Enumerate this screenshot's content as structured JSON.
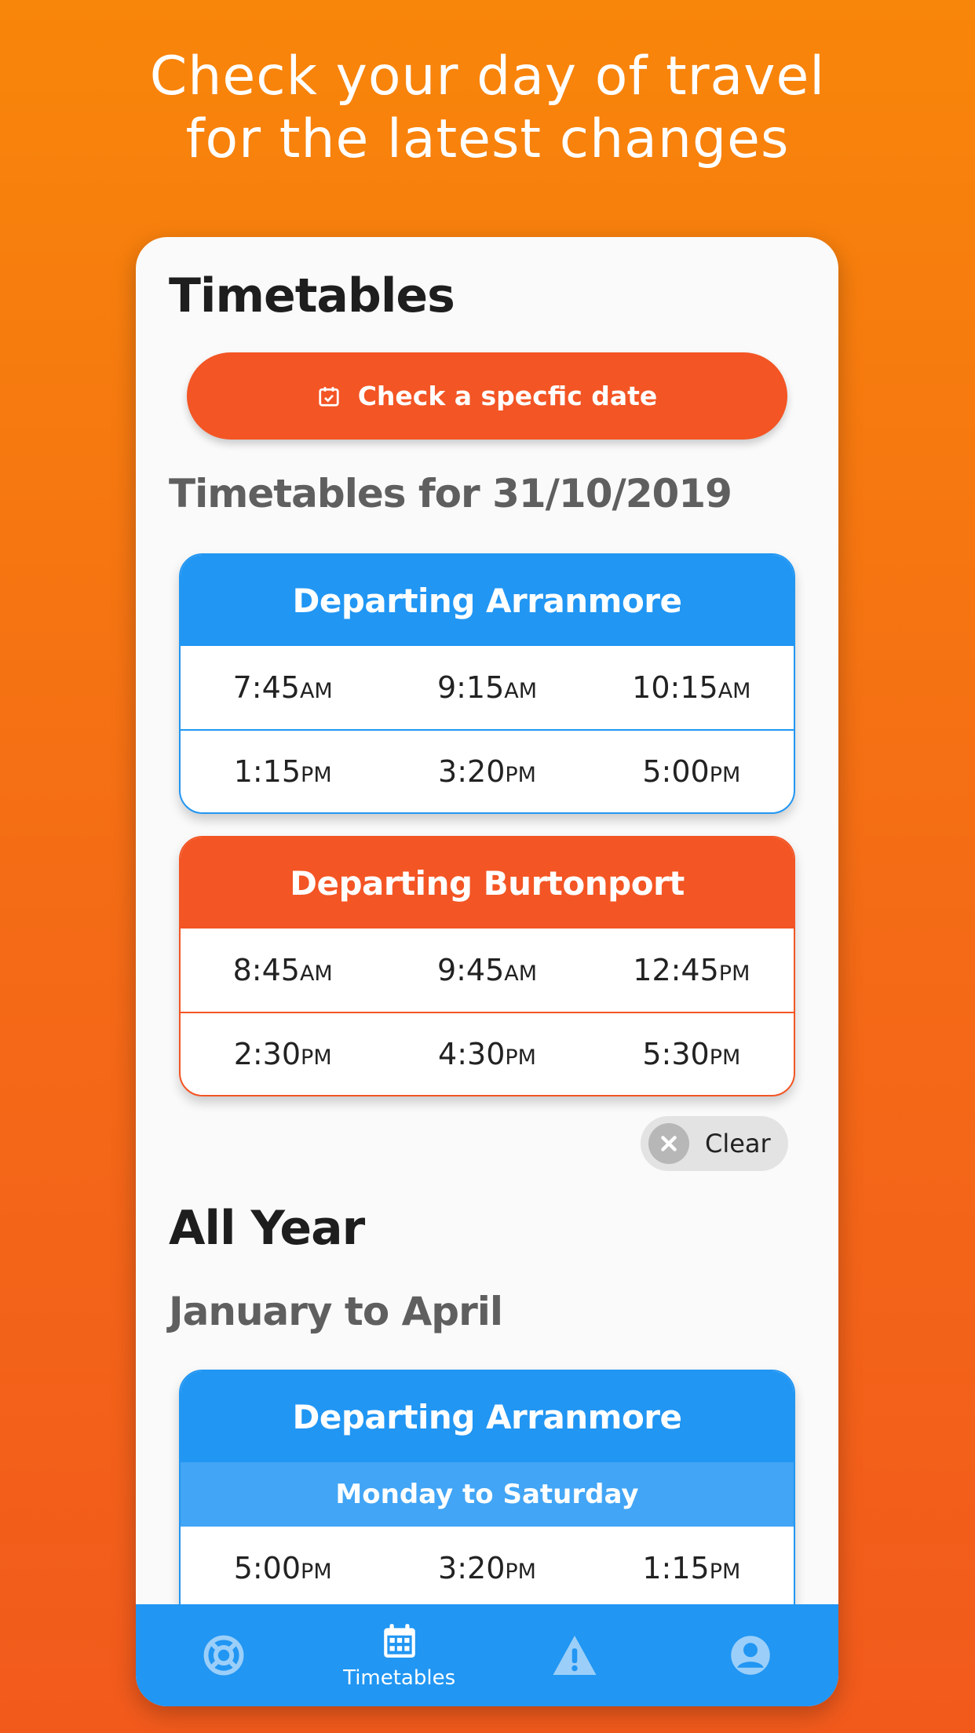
{
  "hero": {
    "line1": "Check your day of travel",
    "line2": "for the latest changes"
  },
  "screen": {
    "title": "Timetables",
    "check_date_button": {
      "label": "Check a specfic date",
      "icon": "calendar-check-icon"
    },
    "date_section_title": "Timetables for 31/10/2019",
    "date_cards": [
      {
        "title": "Departing Arranmore",
        "color": "#2196f3",
        "rows": [
          [
            {
              "t": "7:45",
              "p": "AM"
            },
            {
              "t": "9:15",
              "p": "AM"
            },
            {
              "t": "10:15",
              "p": "AM"
            }
          ],
          [
            {
              "t": "1:15",
              "p": "PM"
            },
            {
              "t": "3:20",
              "p": "PM"
            },
            {
              "t": "5:00",
              "p": "PM"
            }
          ]
        ]
      },
      {
        "title": "Departing Burtonport",
        "color": "#f35524",
        "rows": [
          [
            {
              "t": "8:45",
              "p": "AM"
            },
            {
              "t": "9:45",
              "p": "AM"
            },
            {
              "t": "12:45",
              "p": "PM"
            }
          ],
          [
            {
              "t": "2:30",
              "p": "PM"
            },
            {
              "t": "4:30",
              "p": "PM"
            },
            {
              "t": "5:30",
              "p": "PM"
            }
          ]
        ]
      }
    ],
    "clear_button": {
      "label": "Clear",
      "icon": "close-circle-icon"
    },
    "all_year_title": "All Year",
    "season_title": "January to April",
    "season_card": {
      "title": "Departing Arranmore",
      "subtitle": "Monday to Saturday",
      "rows": [
        [
          {
            "t": "5:00",
            "p": "PM"
          },
          {
            "t": "3:20",
            "p": "PM"
          },
          {
            "t": "1:15",
            "p": "PM"
          }
        ]
      ]
    },
    "nav": [
      {
        "icon": "lifebuoy-icon",
        "label": ""
      },
      {
        "icon": "calendar-icon",
        "label": "Timetables"
      },
      {
        "icon": "warning-icon",
        "label": ""
      },
      {
        "icon": "account-icon",
        "label": ""
      }
    ]
  },
  "colors": {
    "accent_blue": "#2196f3",
    "accent_orange": "#f35524",
    "background_gradient_top": "#f8860a",
    "background_gradient_bottom": "#f25a1c"
  }
}
